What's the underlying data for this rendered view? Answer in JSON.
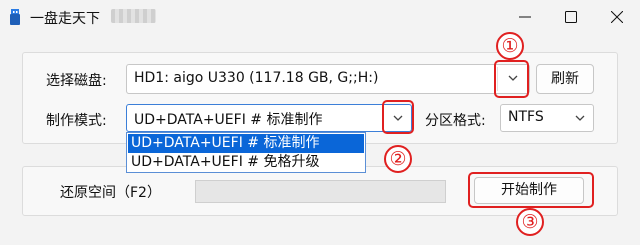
{
  "window": {
    "title": "一盘走天下"
  },
  "disk": {
    "label": "选择磁盘:",
    "value": "HD1: aigo U330 (117.18 GB, G;;H:)",
    "refresh_label": "刷新"
  },
  "mode": {
    "label": "制作模式:",
    "value": "UD+DATA+UEFI # 标准制作",
    "options": [
      "UD+DATA+UEFI # 标准制作",
      "UD+DATA+UEFI # 免格升级"
    ]
  },
  "partition": {
    "label": "分区格式:",
    "value": "NTFS"
  },
  "restore": {
    "label": "还原空间（F2）",
    "progress": 0
  },
  "start_label": "开始制作",
  "markers": [
    "①",
    "②",
    "③"
  ],
  "colors": {
    "highlight_red": "#e02020",
    "selected_blue": "#0a66d8",
    "border_blue": "#5b8fd6"
  }
}
